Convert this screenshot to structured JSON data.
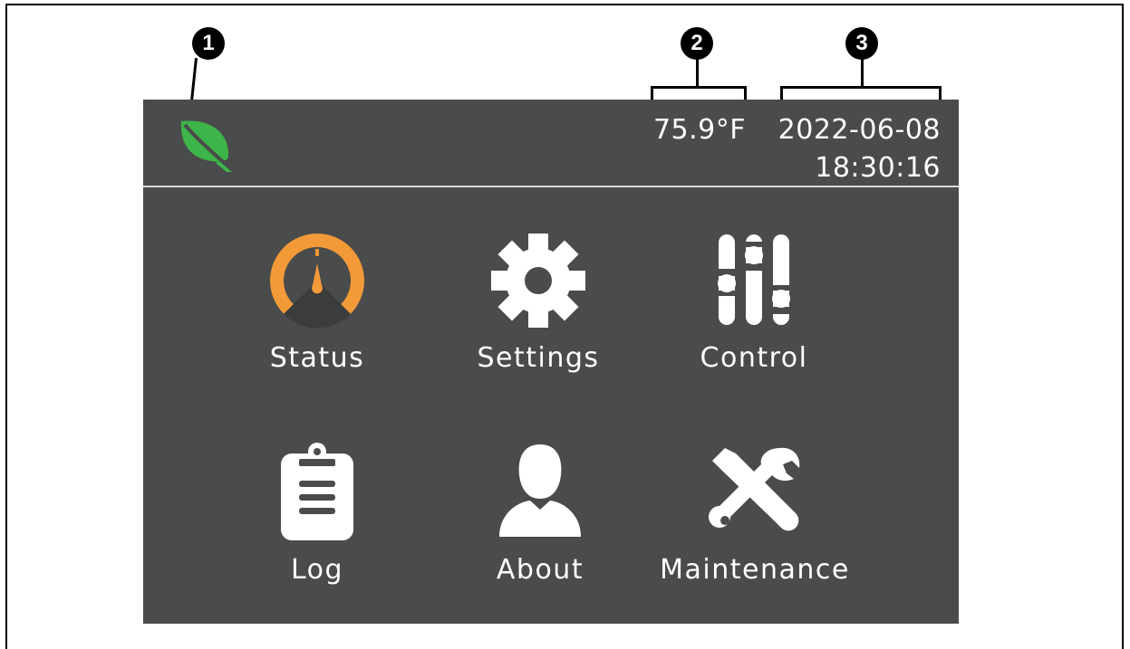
{
  "callouts": [
    "1",
    "2",
    "3"
  ],
  "header": {
    "temperature": "75.9°F",
    "date": "2022-06-08",
    "time": "18:30:16",
    "eco_icon": "leaf-icon"
  },
  "menu": [
    {
      "label": "Status",
      "icon": "gauge-icon"
    },
    {
      "label": "Settings",
      "icon": "gear-icon"
    },
    {
      "label": "Control",
      "icon": "sliders-icon"
    },
    {
      "label": "Log",
      "icon": "clipboard-icon"
    },
    {
      "label": "About",
      "icon": "person-icon"
    },
    {
      "label": "Maintenance",
      "icon": "tools-icon"
    }
  ],
  "colors": {
    "screen_bg": "#4a4b4b",
    "leaf_green": "#3db54a",
    "gauge_orange": "#f29a38",
    "text": "#ffffff"
  }
}
